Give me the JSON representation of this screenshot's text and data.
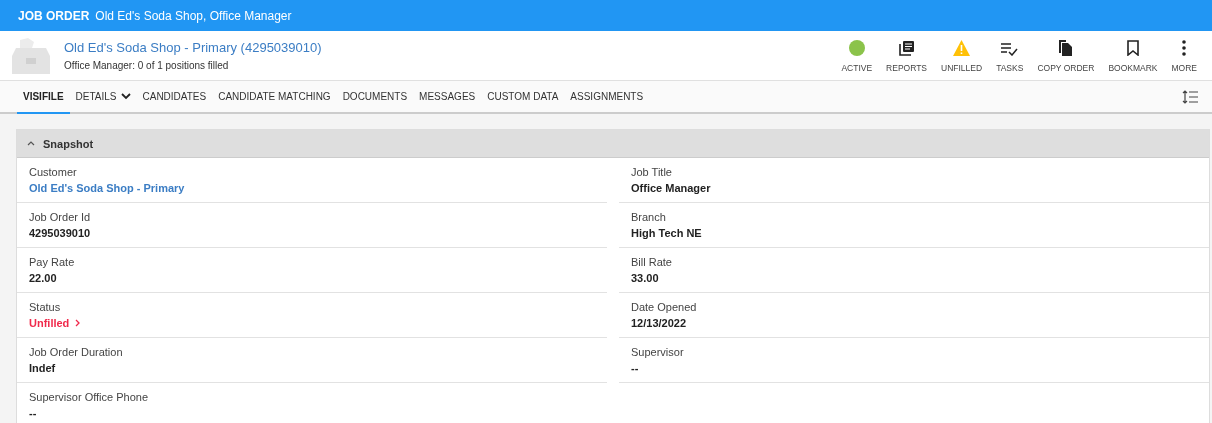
{
  "title_bar": {
    "label": "JOB ORDER",
    "text": "Old Ed's Soda Shop, Office Manager"
  },
  "header": {
    "title": "Old Ed's Soda Shop - Primary (4295039010)",
    "subtitle": "Office Manager: 0 of 1 positions filled"
  },
  "actions": [
    {
      "kind": "status",
      "label": "ACTIVE",
      "color": "#8bc34a"
    },
    {
      "kind": "reports",
      "label": "REPORTS"
    },
    {
      "kind": "warning",
      "label": "UNFILLED",
      "color": "#ffc107"
    },
    {
      "kind": "tasks",
      "label": "TASKS"
    },
    {
      "kind": "copy",
      "label": "COPY ORDER"
    },
    {
      "kind": "bookmark",
      "label": "BOOKMARK"
    },
    {
      "kind": "more",
      "label": "MORE"
    }
  ],
  "tabs": [
    {
      "label": "VISIFILE",
      "selected": true,
      "has_menu": false
    },
    {
      "label": "DETAILS",
      "selected": false,
      "has_menu": true
    },
    {
      "label": "CANDIDATES",
      "selected": false,
      "has_menu": false
    },
    {
      "label": "CANDIDATE MATCHING",
      "selected": false,
      "has_menu": false
    },
    {
      "label": "DOCUMENTS",
      "selected": false,
      "has_menu": false
    },
    {
      "label": "MESSAGES",
      "selected": false,
      "has_menu": false
    },
    {
      "label": "CUSTOM DATA",
      "selected": false,
      "has_menu": false
    },
    {
      "label": "ASSIGNMENTS",
      "selected": false,
      "has_menu": false
    }
  ],
  "snapshot": {
    "title": "Snapshot",
    "expanded": true,
    "left": [
      {
        "label": "Customer",
        "value": "Old Ed's Soda Shop - Primary",
        "kind": "link"
      },
      {
        "label": "Job Order Id",
        "value": "4295039010",
        "kind": "plain"
      },
      {
        "label": "Pay Rate",
        "value": "22.00",
        "kind": "plain"
      },
      {
        "label": "Status",
        "value": "Unfilled",
        "kind": "status"
      },
      {
        "label": "Job Order Duration",
        "value": "Indef",
        "kind": "plain"
      },
      {
        "label": "Supervisor Office Phone",
        "value": "--",
        "kind": "plain"
      }
    ],
    "right": [
      {
        "label": "Job Title",
        "value": "Office Manager",
        "kind": "plain"
      },
      {
        "label": "Branch",
        "value": "High Tech NE",
        "kind": "plain"
      },
      {
        "label": "Bill Rate",
        "value": "33.00",
        "kind": "plain"
      },
      {
        "label": "Date Opened",
        "value": "12/13/2022",
        "kind": "plain"
      },
      {
        "label": "Supervisor",
        "value": "--",
        "kind": "plain"
      }
    ]
  }
}
